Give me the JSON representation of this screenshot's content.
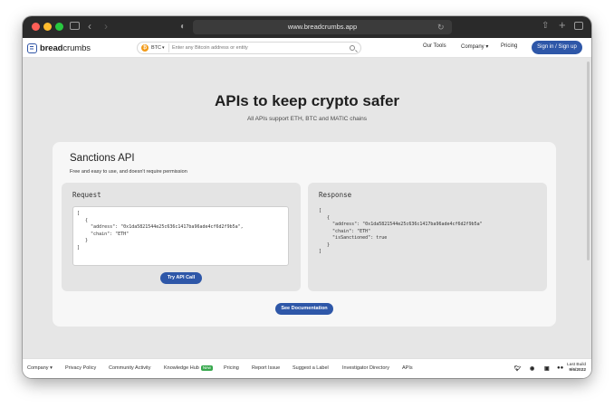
{
  "browser": {
    "url": "www.breadcrumbs.app",
    "traffic_light_colors": [
      "#ff5f57",
      "#febc2e",
      "#28c840"
    ],
    "toolbar_icons": [
      "sidebar-icon",
      "back-icon",
      "forward-icon",
      "privacy-shield-icon",
      "reload-icon",
      "share-icon",
      "new-tab-icon",
      "tabs-overview-icon"
    ]
  },
  "nav": {
    "logo_prefix": "bread",
    "logo_suffix": "crumbs",
    "coin_label": "BTC",
    "coin_symbol": "₿",
    "search_placeholder": "Enter any Bitcoin address or entity",
    "links": [
      "Our Tools",
      "Company",
      "Pricing"
    ],
    "company_caret": "▾",
    "signin_label": "Sign in / Sign up",
    "accent_color": "#2e57a8"
  },
  "hero": {
    "title": "APIs to keep crypto safer",
    "subtitle": "All APIs support ETH, BTC and MATIC chains"
  },
  "card": {
    "title": "Sanctions API",
    "description": "Free and easy to use, and doesn't require permission",
    "request": {
      "label": "Request",
      "code": "[\n   {\n     \"address\": \"0x1da5821544e25c636c1417ba96ade4cf6d2f9b5a\",\n     \"chain\": \"ETH\"\n   }\n]",
      "button_label": "Try API Call"
    },
    "response": {
      "label": "Response",
      "code": "[\n   {\n     \"address\": \"0x1da5821544e25c636c1417ba96ade4cf6d2f9b5a\"\n     \"chain\": \"ETH\"\n     \"isSanctioned\": true\n   }\n]"
    },
    "docs_button_label": "See Documentation"
  },
  "footer": {
    "company_label": "Company ▾",
    "links": [
      "Privacy Policy",
      "Community Activity",
      "Knowledge Hub",
      "Pricing",
      "Report Issue",
      "Suggest a Label",
      "Investigator Directory",
      "APIs"
    ],
    "new_badge": "New",
    "social_icons": [
      "twitter-icon",
      "discord-icon",
      "linkedin-icon",
      "medium-icon"
    ],
    "last_build_label": "Last Build",
    "last_build_date": "9/6/2022"
  }
}
